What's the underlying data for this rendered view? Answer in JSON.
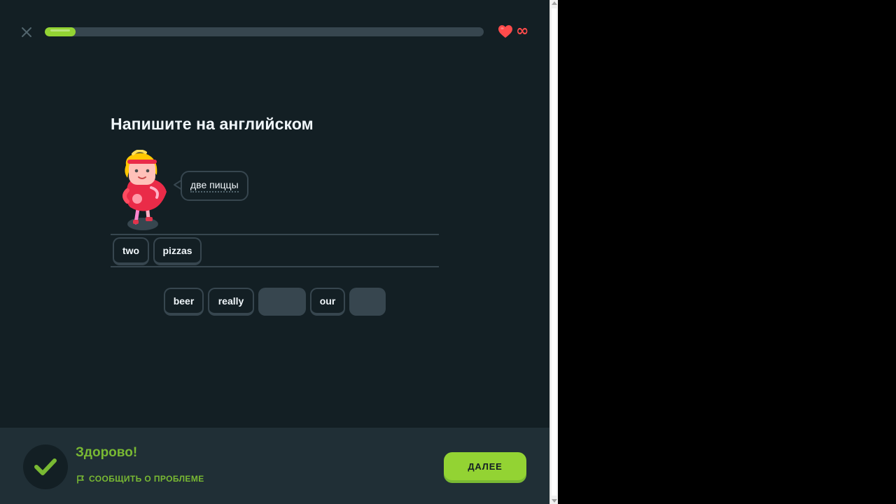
{
  "header": {
    "close_icon": "close-icon",
    "progress": 0.07,
    "hearts_icon": "heart-icon",
    "hearts_count": "∞"
  },
  "lesson": {
    "title": "Напишите на английском",
    "prompt": "две пиццы",
    "answer_words": [
      "two",
      "pizzas"
    ],
    "word_bank": [
      {
        "label": "beer",
        "used": false
      },
      {
        "label": "really",
        "used": false
      },
      {
        "label": "",
        "used": true
      },
      {
        "label": "our",
        "used": false
      },
      {
        "label": "",
        "used": true
      }
    ]
  },
  "footer": {
    "result_title": "Здорово!",
    "report_label": "СООБЩИТЬ О ПРОБЛЕМЕ",
    "report_icon": "flag-icon",
    "next_label": "ДАЛЕЕ",
    "check_icon": "check-icon"
  },
  "colors": {
    "accent_green": "#93d333",
    "success_text": "#79b933",
    "heart_red": "#ff4b4b",
    "background": "#131f24"
  }
}
